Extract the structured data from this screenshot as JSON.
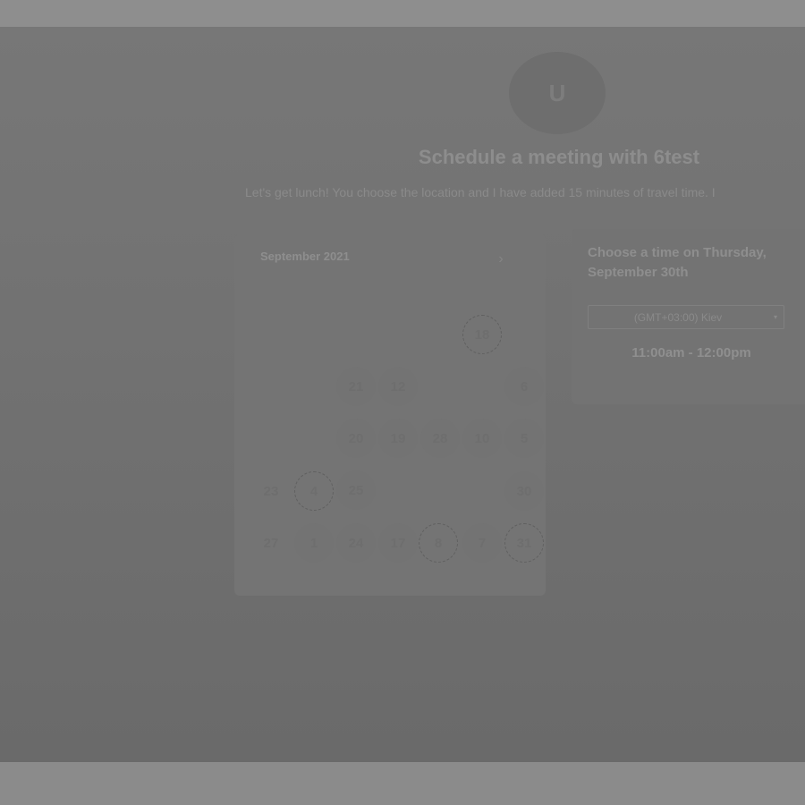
{
  "header": {
    "avatar_glyph": "U",
    "title": "Schedule a meeting with 6test",
    "description": "Let's get lunch! You choose the location and I have added 15 minutes of travel time. I"
  },
  "calendar": {
    "month_label": "September 2021",
    "next_icon": "chevron-right-icon",
    "days": [
      "18",
      "21",
      "12",
      "6",
      "20",
      "19",
      "28",
      "10",
      "5",
      "23",
      "4",
      "25",
      "30",
      "27",
      "1",
      "24",
      "17",
      "8",
      "7",
      "31"
    ]
  },
  "times": {
    "heading": "Choose a time on Thursday, September 30th",
    "timezone": "(GMT+03:00) Kiev",
    "timezone_caret": "▾",
    "slot": "11:00am - 12:00pm"
  },
  "colors": {
    "overlay": "#6f6f6f",
    "panel": "#747474",
    "text": "#8e8e8e"
  }
}
